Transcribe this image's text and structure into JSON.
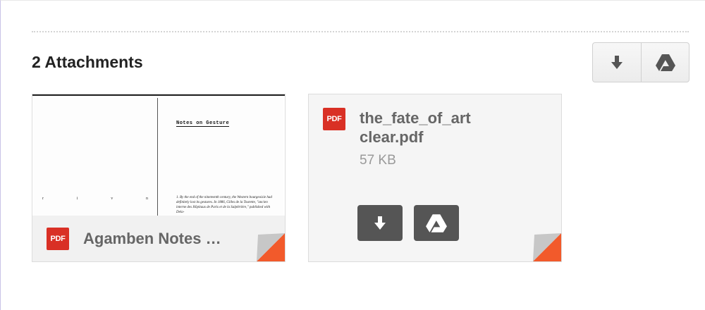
{
  "attachments": {
    "heading": "2 Attachments"
  },
  "toolbar": {
    "download_all_icon": "download-icon",
    "save_all_to_drive_icon": "drive-icon"
  },
  "files": [
    {
      "icon_label": "PDF",
      "name": "Agamben Notes …",
      "thumbnail": {
        "title": "Notes on Gesture",
        "marks": [
          "r",
          "i",
          "v",
          "n"
        ],
        "body": "1. By the end of the nineteenth century, the Western bourgeoisie had definitely lost its gestures. In 1886, Gilles de la Tourette, \"ancien interne des Hôpitaux de Paris et de la Salpêtrière,\" published with Dela-"
      }
    },
    {
      "icon_label": "PDF",
      "name": "the_fate_of_art clear.pdf",
      "size": "57 KB"
    }
  ],
  "colors": {
    "pdf_red": "#d93025",
    "corner_orange": "#f25a2b",
    "dark_button": "#555555"
  }
}
